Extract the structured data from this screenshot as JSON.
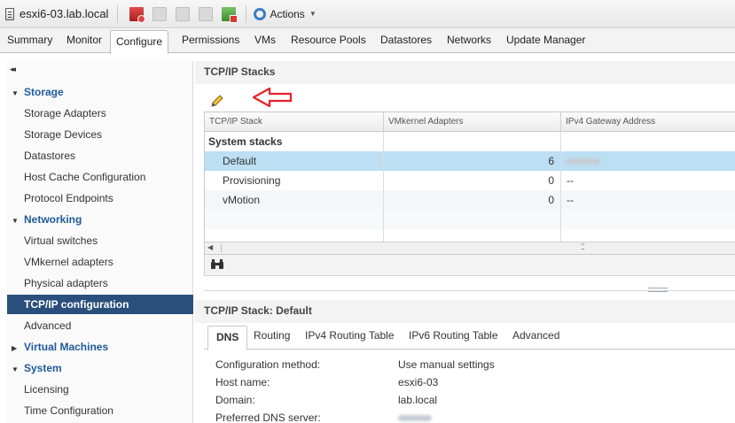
{
  "window": {
    "title": "esxi6-03.lab.local"
  },
  "toolbar": {
    "actions_label": "Actions",
    "icons": [
      "vm-add-icon",
      "vm-clone-icon",
      "vm-migrate-icon",
      "vm-folder-icon",
      "vm-remove-icon",
      "gear-icon"
    ]
  },
  "tabs": [
    "Summary",
    "Monitor",
    "Configure",
    "Permissions",
    "VMs",
    "Resource Pools",
    "Datastores",
    "Networks",
    "Update Manager"
  ],
  "active_tab": "Configure",
  "nav": {
    "collapse_glyph": "◂◂",
    "items": [
      {
        "label": "Storage",
        "type": "section",
        "expanded": true
      },
      {
        "label": "Storage Adapters",
        "type": "item"
      },
      {
        "label": "Storage Devices",
        "type": "item"
      },
      {
        "label": "Datastores",
        "type": "item"
      },
      {
        "label": "Host Cache Configuration",
        "type": "item"
      },
      {
        "label": "Protocol Endpoints",
        "type": "item"
      },
      {
        "label": "Networking",
        "type": "section",
        "expanded": true
      },
      {
        "label": "Virtual switches",
        "type": "item"
      },
      {
        "label": "VMkernel adapters",
        "type": "item"
      },
      {
        "label": "Physical adapters",
        "type": "item"
      },
      {
        "label": "TCP/IP configuration",
        "type": "item",
        "selected": true
      },
      {
        "label": "Advanced",
        "type": "item"
      },
      {
        "label": "Virtual Machines",
        "type": "section",
        "expanded": false
      },
      {
        "label": "System",
        "type": "section",
        "expanded": true
      },
      {
        "label": "Licensing",
        "type": "item"
      },
      {
        "label": "Time Configuration",
        "type": "item"
      }
    ]
  },
  "stacks": {
    "title": "TCP/IP Stacks",
    "columns": [
      "TCP/IP Stack",
      "VMkernel Adapters",
      "IPv4 Gateway Address"
    ],
    "group_label": "System stacks",
    "rows": [
      {
        "name": "Default",
        "adapters": "6",
        "gateway": "",
        "selected": true
      },
      {
        "name": "Provisioning",
        "adapters": "0",
        "gateway": "--"
      },
      {
        "name": "vMotion",
        "adapters": "0",
        "gateway": "--"
      }
    ]
  },
  "detail": {
    "title": "TCP/IP Stack: Default",
    "tabs": [
      "DNS",
      "Routing",
      "IPv4 Routing Table",
      "IPv6 Routing Table",
      "Advanced"
    ],
    "active_tab": "DNS",
    "properties": [
      {
        "label": "Configuration method:",
        "value": "Use manual settings"
      },
      {
        "label": "Host name:",
        "value": "esxi6-03"
      },
      {
        "label": "Domain:",
        "value": "lab.local"
      },
      {
        "label": "Preferred DNS server:",
        "value": ""
      }
    ]
  },
  "colors": {
    "nav_selected": "#2a4f7c",
    "row_selected": "#bcdff3",
    "section_label": "#1f5b9a",
    "annotation_arrow": "#e8202a"
  }
}
